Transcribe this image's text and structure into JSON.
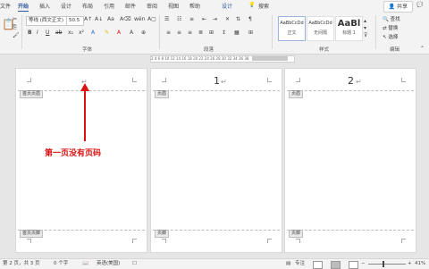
{
  "tabs": [
    "文件",
    "开始",
    "插入",
    "设计",
    "布局",
    "引用",
    "邮件",
    "审阅",
    "视图",
    "帮助",
    "设计",
    "搜索"
  ],
  "share": "共享",
  "ribbon": {
    "font_name": "等线 (西文正文)",
    "font_size": "50.5",
    "groups": [
      "字体",
      "段落",
      "样式",
      "编辑"
    ],
    "styles": [
      {
        "sample": "AaBbCcDd",
        "name": "正文"
      },
      {
        "sample": "AaBbCcDd",
        "name": "无间隔"
      },
      {
        "sample": "AaBl",
        "name": "标题 1"
      }
    ],
    "editing": [
      "查找",
      "替换",
      "选择"
    ],
    "bold": "B",
    "italic": "I",
    "underline": "U",
    "font_color_glyph": "A"
  },
  "ruler": "2 4 6 8 10 12 14 16 18 20 22 24 26 28 30 32 34 36 38",
  "pages": [
    {
      "header_tag": "首页页眉",
      "footer_tag": "首页页脚",
      "page_number": ""
    },
    {
      "header_tag": "页眉",
      "footer_tag": "页脚",
      "page_number": "1"
    },
    {
      "header_tag": "页眉",
      "footer_tag": "页脚",
      "page_number": "2"
    }
  ],
  "annotation": "第一页没有页码",
  "status": {
    "page": "第 2 页，共 3 页",
    "words": "0 个字",
    "lang": "英语(美国)",
    "focus": "专注",
    "zoom": "41%"
  },
  "colors": {
    "accent": "#2b579a",
    "annotation": "#dd1111"
  }
}
